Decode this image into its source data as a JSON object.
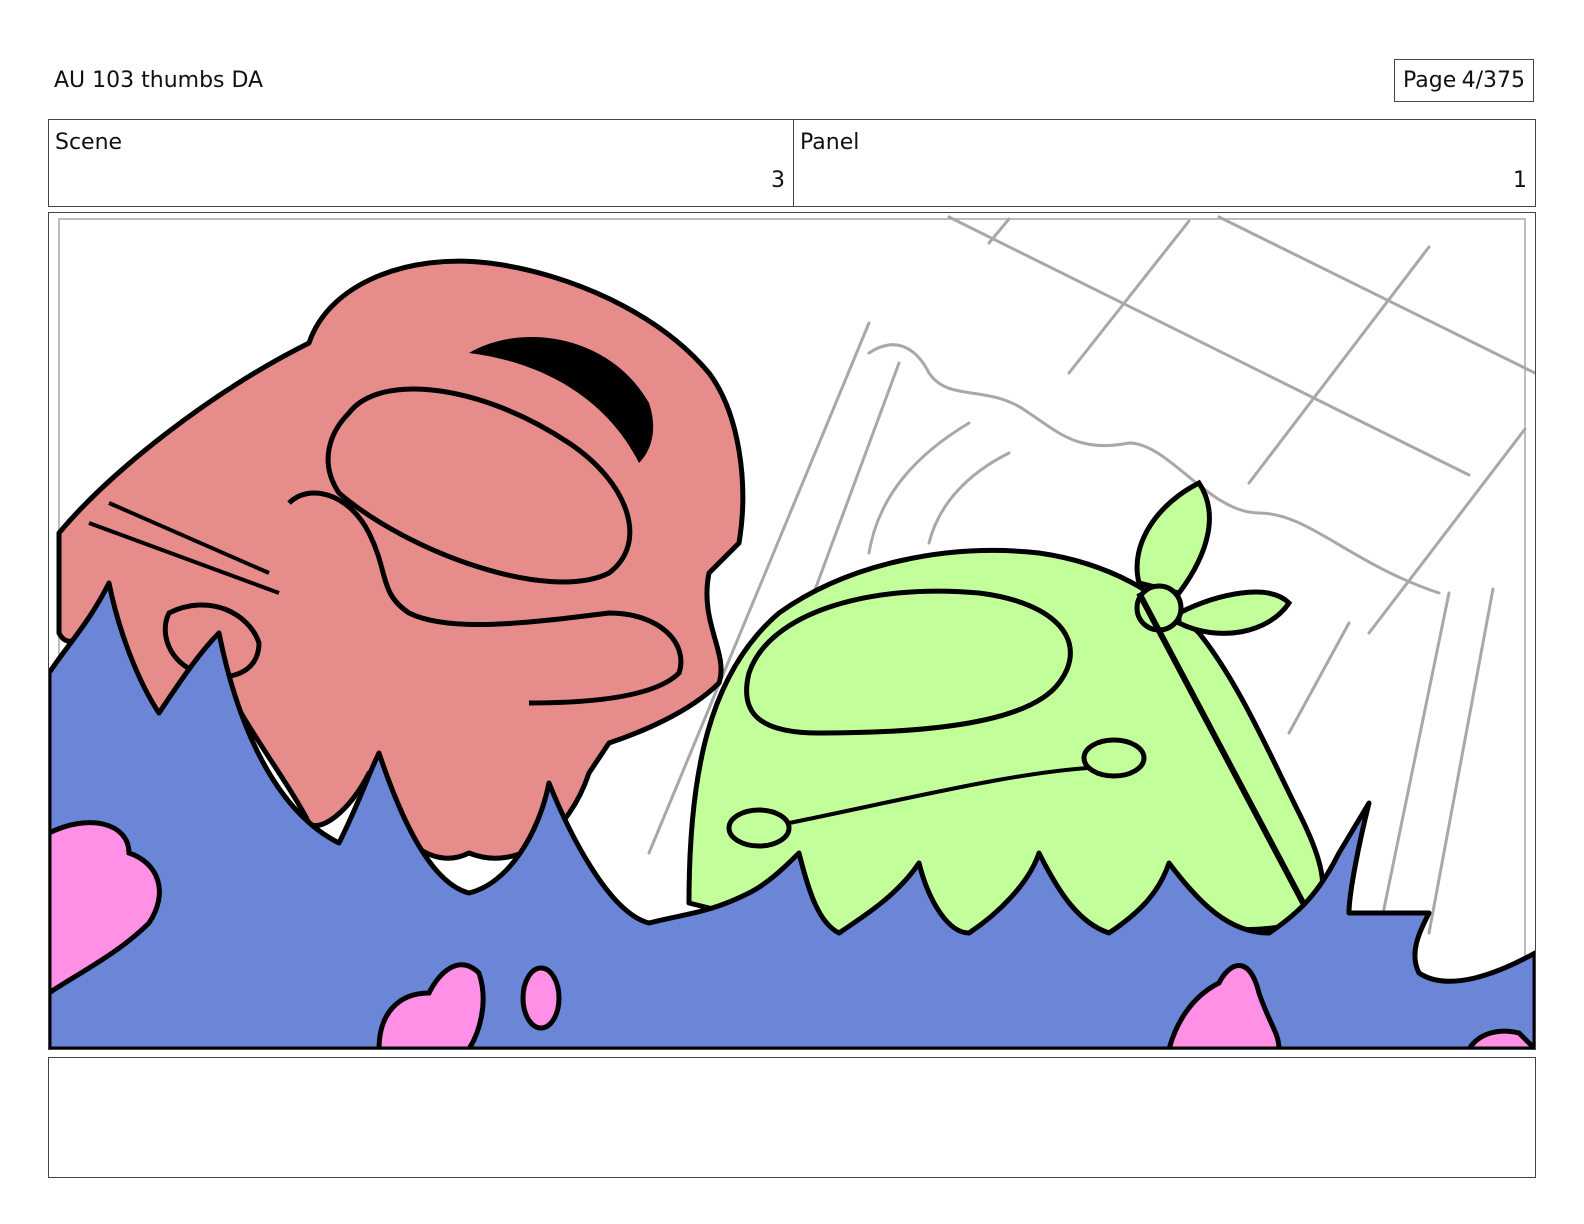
{
  "header": {
    "title": "AU 103 thumbs DA",
    "page_label": "Page",
    "page_value": "4/375"
  },
  "fields": {
    "scene_label": "Scene",
    "scene_value": "3",
    "panel_label": "Panel",
    "panel_value": "1"
  },
  "colors": {
    "red_character": "#e68c8a",
    "green_character": "#c2ff9a",
    "water": "#6b86d6",
    "pink_splash": "#ff90e6",
    "sketch_lines": "#a8a8a8"
  },
  "notes": {
    "text": ""
  }
}
